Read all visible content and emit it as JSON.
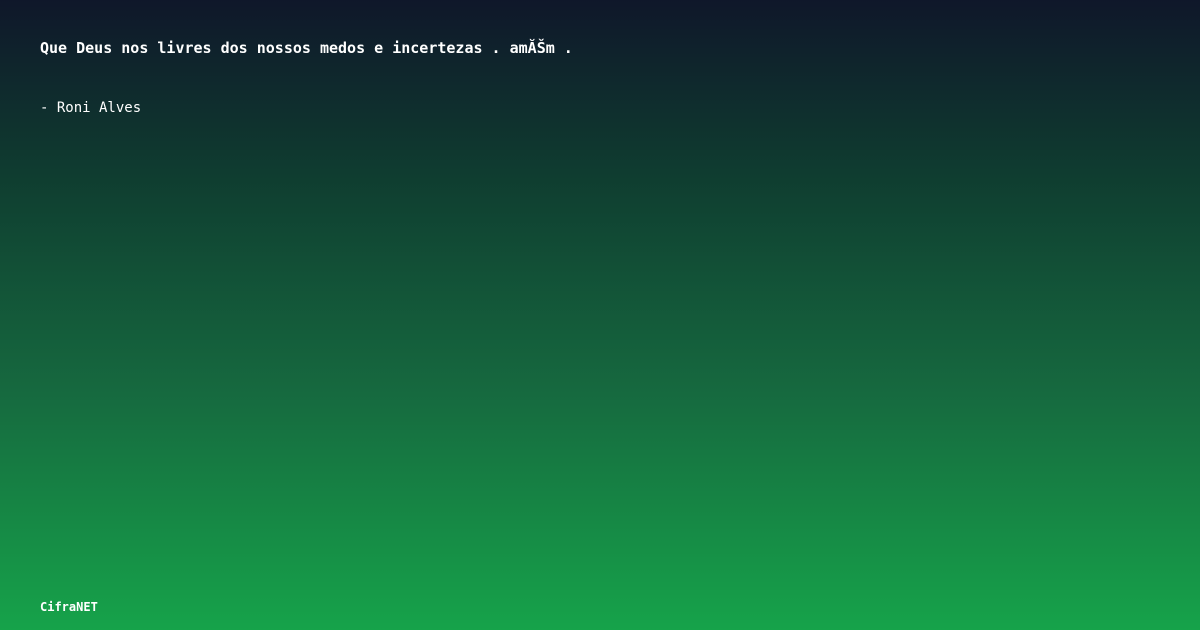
{
  "quote": {
    "text": "Que Deus nos livres dos nossos medos e incertezas . amĂŠm .",
    "author": "- Roni Alves"
  },
  "footer": {
    "brand": "CifraNET"
  }
}
